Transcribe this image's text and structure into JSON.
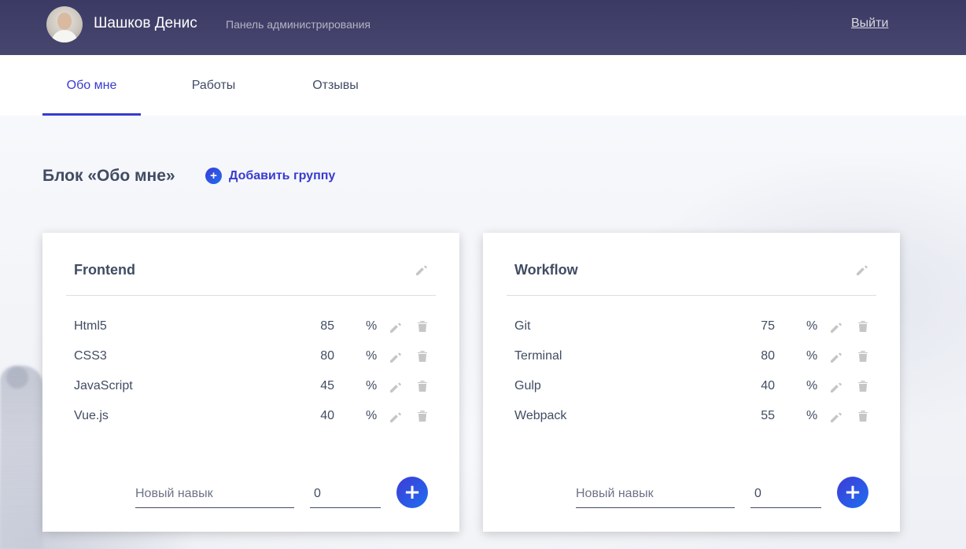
{
  "header": {
    "user_name": "Шашков Денис",
    "subtitle": "Панель администрирования",
    "logout_label": "Выйти"
  },
  "tabs": [
    {
      "label": "Обо мне",
      "active": true
    },
    {
      "label": "Работы",
      "active": false
    },
    {
      "label": "Отзывы",
      "active": false
    }
  ],
  "section": {
    "title": "Блок «Обо мне»",
    "add_group_label": "Добавить группу"
  },
  "groups": [
    {
      "title": "Frontend",
      "skills": [
        {
          "name": "Html5",
          "value": "85"
        },
        {
          "name": "CSS3",
          "value": "80"
        },
        {
          "name": "JavaScript",
          "value": "45"
        },
        {
          "name": "Vue.js",
          "value": "40"
        }
      ],
      "new_skill_placeholder": "Новый навык",
      "new_value": "0"
    },
    {
      "title": "Workflow",
      "skills": [
        {
          "name": "Git",
          "value": "75"
        },
        {
          "name": "Terminal",
          "value": "80"
        },
        {
          "name": "Gulp",
          "value": "40"
        },
        {
          "name": "Webpack",
          "value": "55"
        }
      ],
      "new_skill_placeholder": "Новый навык",
      "new_value": "0"
    }
  ],
  "percent_sign": "%",
  "colors": {
    "header_bg": "#3b3a64",
    "accent": "#383bcf",
    "text": "#414c63",
    "icon_gray": "#c6c6c6"
  }
}
